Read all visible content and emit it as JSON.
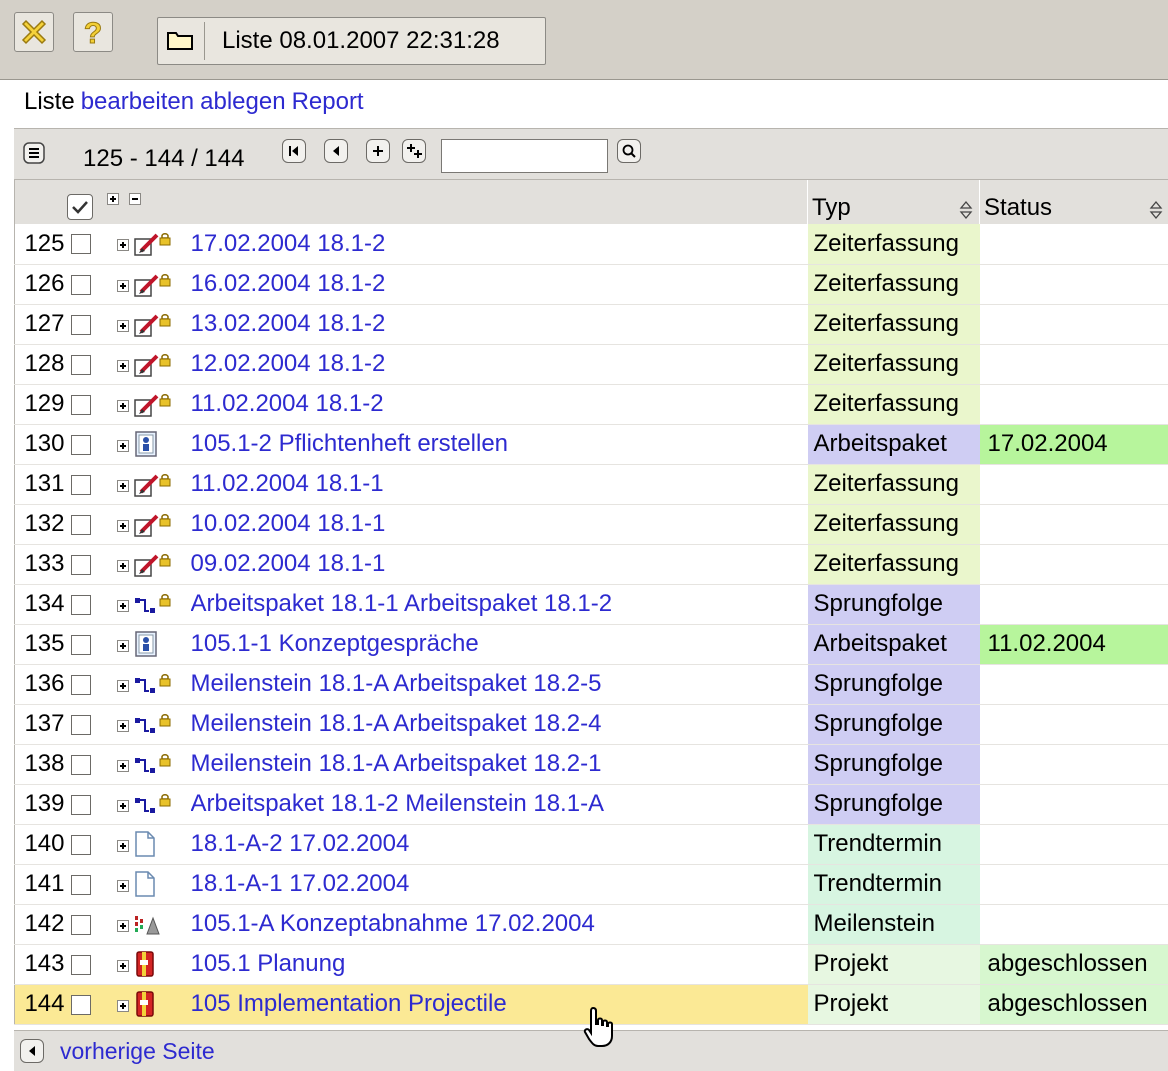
{
  "toolbar": {
    "close_icon": "close-x-icon",
    "help_icon": "help-question-icon",
    "list_title": "Liste 08.01.2007 22:31:28"
  },
  "menu": {
    "label": "Liste",
    "links": [
      "bearbeiten",
      "ablegen",
      "Report"
    ]
  },
  "pager": {
    "range": "125 - 144 / 144",
    "search_value": ""
  },
  "table": {
    "columns": {
      "typ": "Typ",
      "status": "Status"
    },
    "type_colors": {
      "Zeiterfassung": "#eaf6cc",
      "Arbeitspaket": "#cfcdf3",
      "Sprungfolge": "#cfcdf3",
      "Trendtermin": "#d7f5e1",
      "Meilenstein": "#d7f5e1",
      "Projekt": "#e7f7e1"
    },
    "status_colors": {
      "date": "#b7f59c",
      "abgeschlossen": "#d7f7cf"
    },
    "rows": [
      {
        "num": "125",
        "icon": "time-entry-icon",
        "name": "17.02.2004 18.1-2",
        "typ": "Zeiterfassung",
        "status": ""
      },
      {
        "num": "126",
        "icon": "time-entry-icon",
        "name": "16.02.2004 18.1-2",
        "typ": "Zeiterfassung",
        "status": ""
      },
      {
        "num": "127",
        "icon": "time-entry-icon",
        "name": "13.02.2004 18.1-2",
        "typ": "Zeiterfassung",
        "status": ""
      },
      {
        "num": "128",
        "icon": "time-entry-icon",
        "name": "12.02.2004 18.1-2",
        "typ": "Zeiterfassung",
        "status": ""
      },
      {
        "num": "129",
        "icon": "time-entry-icon",
        "name": "11.02.2004 18.1-2",
        "typ": "Zeiterfassung",
        "status": ""
      },
      {
        "num": "130",
        "icon": "work-package-icon",
        "name": "105.1-2 Pflichtenheft erstellen",
        "typ": "Arbeitspaket",
        "status": "17.02.2004"
      },
      {
        "num": "131",
        "icon": "time-entry-icon",
        "name": "11.02.2004 18.1-1",
        "typ": "Zeiterfassung",
        "status": ""
      },
      {
        "num": "132",
        "icon": "time-entry-icon",
        "name": "10.02.2004 18.1-1",
        "typ": "Zeiterfassung",
        "status": ""
      },
      {
        "num": "133",
        "icon": "time-entry-icon",
        "name": "09.02.2004 18.1-1",
        "typ": "Zeiterfassung",
        "status": ""
      },
      {
        "num": "134",
        "icon": "dependency-icon",
        "name": "Arbeitspaket 18.1-1 Arbeitspaket 18.1-2",
        "typ": "Sprungfolge",
        "status": ""
      },
      {
        "num": "135",
        "icon": "work-package-icon",
        "name": "105.1-1 Konzeptgespräche",
        "typ": "Arbeitspaket",
        "status": "11.02.2004"
      },
      {
        "num": "136",
        "icon": "dependency-icon",
        "name": "Meilenstein 18.1-A Arbeitspaket 18.2-5",
        "typ": "Sprungfolge",
        "status": ""
      },
      {
        "num": "137",
        "icon": "dependency-icon",
        "name": "Meilenstein 18.1-A Arbeitspaket 18.2-4",
        "typ": "Sprungfolge",
        "status": ""
      },
      {
        "num": "138",
        "icon": "dependency-icon",
        "name": "Meilenstein 18.1-A Arbeitspaket 18.2-1",
        "typ": "Sprungfolge",
        "status": ""
      },
      {
        "num": "139",
        "icon": "dependency-icon",
        "name": "Arbeitspaket 18.1-2 Meilenstein 18.1-A",
        "typ": "Sprungfolge",
        "status": ""
      },
      {
        "num": "140",
        "icon": "document-icon",
        "name": "18.1-A-2 17.02.2004",
        "typ": "Trendtermin",
        "status": ""
      },
      {
        "num": "141",
        "icon": "document-icon",
        "name": "18.1-A-1 17.02.2004",
        "typ": "Trendtermin",
        "status": ""
      },
      {
        "num": "142",
        "icon": "milestone-icon",
        "name": "105.1-A Konzeptabnahme 17.02.2004",
        "typ": "Meilenstein",
        "status": ""
      },
      {
        "num": "143",
        "icon": "project-icon",
        "name": "105.1 Planung",
        "typ": "Projekt",
        "status": "abgeschlossen"
      },
      {
        "num": "144",
        "icon": "project-icon",
        "name": "105 Implementation Projectile",
        "typ": "Projekt",
        "status": "abgeschlossen",
        "highlighted": true
      }
    ]
  },
  "footer": {
    "prev_page": "vorherige Seite"
  }
}
